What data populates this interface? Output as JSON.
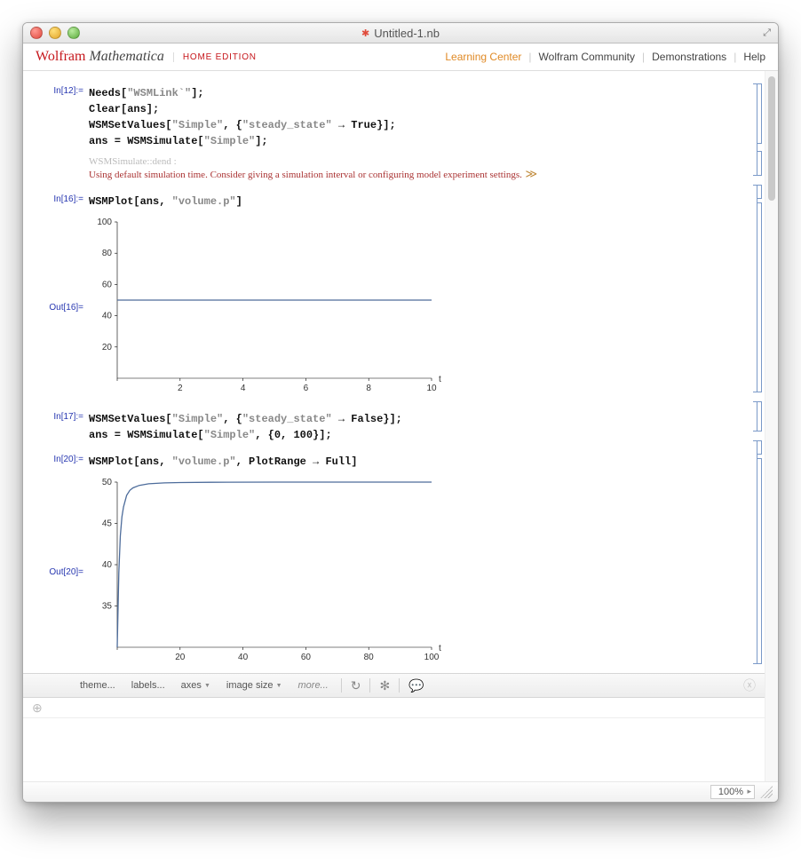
{
  "window": {
    "title": "Untitled-1.nb"
  },
  "header": {
    "brand_wolfram": "Wolfram",
    "brand_mathematica": "Mathematica",
    "home_edition": "HOME EDITION",
    "links": {
      "learning_center": "Learning Center",
      "wolfram_community": "Wolfram Community",
      "demonstrations": "Demonstrations",
      "help": "Help"
    }
  },
  "cells": {
    "in12": {
      "label": "In[12]:=",
      "code_l1a": "Needs[",
      "code_l1b": "\"WSMLink`\"",
      "code_l1c": "];",
      "code_l2a": "Clear[ans];",
      "code_l3a": "WSMSetValues[",
      "code_l3b": "\"Simple\"",
      "code_l3c": ", {",
      "code_l3d": "\"steady_state\"",
      "code_l3e": " → True}];",
      "code_l4a": "ans = WSMSimulate[",
      "code_l4b": "\"Simple\"",
      "code_l4c": "];"
    },
    "msg": {
      "tag": "WSMSimulate::dend :",
      "body": "Using default simulation time. Consider giving a simulation interval or configuring model experiment settings.",
      "more": "≫"
    },
    "in16": {
      "label": "In[16]:=",
      "code_a": "WSMPlot[ans, ",
      "code_b": "\"volume.p\"",
      "code_c": "]"
    },
    "out16": {
      "label": "Out[16]="
    },
    "in17": {
      "label": "In[17]:=",
      "l1a": "WSMSetValues[",
      "l1b": "\"Simple\"",
      "l1c": ", {",
      "l1d": "\"steady_state\"",
      "l1e": " → False}];",
      "l2a": "ans = WSMSimulate[",
      "l2b": "\"Simple\"",
      "l2c": ", {0, 100}];"
    },
    "in20": {
      "label": "In[20]:=",
      "code_a": "WSMPlot[ans, ",
      "code_b": "\"volume.p\"",
      "code_c": ", PlotRange → Full]"
    },
    "out20": {
      "label": "Out[20]="
    }
  },
  "toolbar": {
    "theme": "theme...",
    "labels": "labels...",
    "axes": "axes",
    "image_size": "image size",
    "more": "more..."
  },
  "status": {
    "zoom": "100%"
  },
  "chart_data": [
    {
      "type": "line",
      "title": "",
      "xlabel": "t",
      "ylabel": "",
      "xlim": [
        0,
        10
      ],
      "ylim": [
        0,
        100
      ],
      "xticks": [
        0,
        2,
        4,
        6,
        8,
        10
      ],
      "yticks": [
        20,
        40,
        60,
        80,
        100
      ],
      "series": [
        {
          "name": "volume.p",
          "x": [
            0,
            10
          ],
          "y": [
            50,
            50
          ]
        }
      ]
    },
    {
      "type": "line",
      "title": "",
      "xlabel": "t",
      "ylabel": "",
      "xlim": [
        0,
        100
      ],
      "ylim": [
        30,
        50
      ],
      "xticks": [
        0,
        20,
        40,
        60,
        80,
        100
      ],
      "yticks": [
        35,
        40,
        45,
        50
      ],
      "series": [
        {
          "name": "volume.p",
          "x": [
            0,
            0.5,
            1,
            1.5,
            2,
            3,
            4,
            5,
            7,
            10,
            15,
            20,
            30,
            50,
            100
          ],
          "y": [
            30,
            39,
            43.5,
            45.8,
            47,
            48.4,
            49,
            49.3,
            49.6,
            49.8,
            49.9,
            49.95,
            49.98,
            50,
            50
          ]
        }
      ]
    }
  ]
}
